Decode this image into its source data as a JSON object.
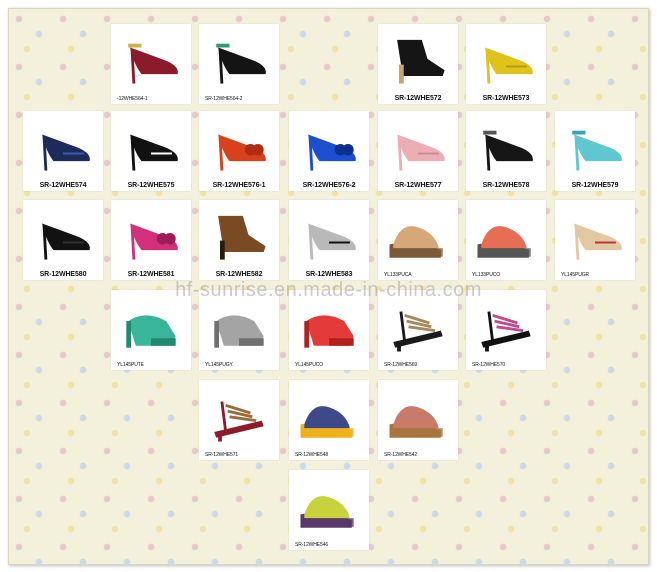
{
  "watermark": "hf-sunrise.en.made-in-china.com",
  "products": [
    {
      "label": "-12WHE564-1",
      "small": true,
      "color": "#8b1a2a",
      "accent": "#c9b24a",
      "style": "strap"
    },
    {
      "label": "SR-12WHE564-2",
      "small": true,
      "color": "#141414",
      "accent": "#2f9e6e",
      "style": "strap"
    },
    {
      "label": "SR-12WHE572",
      "small": false,
      "color": "#151515",
      "accent": "#c9a36a",
      "style": "bootie"
    },
    {
      "label": "SR-12WHE573",
      "small": false,
      "color": "#e0c21c",
      "accent": "#b99a10",
      "style": "pump"
    },
    {
      "label": "SR-12WHE574",
      "small": false,
      "color": "#1d2b5a",
      "accent": "#3c5bb0",
      "style": "pump"
    },
    {
      "label": "SR-12WHE575",
      "small": false,
      "color": "#111111",
      "accent": "#ffffff",
      "style": "pump"
    },
    {
      "label": "SR-12WHE576-1",
      "small": false,
      "color": "#d9401c",
      "accent": "#b02c10",
      "style": "bow"
    },
    {
      "label": "SR-12WHE576-2",
      "small": false,
      "color": "#1b4fcf",
      "accent": "#0d2f8f",
      "style": "bow"
    },
    {
      "label": "SR-12WHE577",
      "small": false,
      "color": "#ecaeb5",
      "accent": "#d18a92",
      "style": "pump"
    },
    {
      "label": "SR-12WHE578",
      "small": false,
      "color": "#161616",
      "accent": "#555555",
      "style": "strap"
    },
    {
      "label": "SR-12WHE579",
      "small": false,
      "color": "#5fc7cf",
      "accent": "#3aa3ad",
      "style": "strap"
    },
    {
      "label": "SR-12WHE580",
      "small": false,
      "color": "#121212",
      "accent": "#333333",
      "style": "pump"
    },
    {
      "label": "SR-12WHE581",
      "small": false,
      "color": "#d2307a",
      "accent": "#a01b59",
      "style": "bow"
    },
    {
      "label": "SR-12WHE582",
      "small": false,
      "color": "#7a4a22",
      "accent": "#2a1a0c",
      "style": "bootie"
    },
    {
      "label": "SR-12WHE583",
      "small": false,
      "color": "#b9b9b9",
      "accent": "#111111",
      "style": "pump"
    },
    {
      "label": "YL133PUCA",
      "small": true,
      "color": "#d6a878",
      "accent": "#7a5a3a",
      "style": "wedge"
    },
    {
      "label": "YL133PUCO",
      "small": true,
      "color": "#e76d55",
      "accent": "#555555",
      "style": "wedge"
    },
    {
      "label": "YL145PUGR",
      "small": true,
      "color": "#e2c8a3",
      "accent": "#b8373a",
      "style": "pump"
    },
    {
      "label": "YL145PUTE",
      "small": true,
      "color": "#39b59a",
      "accent": "#1f8a70",
      "style": "platform"
    },
    {
      "label": "YL145PUGY",
      "small": true,
      "color": "#a4a4a4",
      "accent": "#6f6f6f",
      "style": "platform"
    },
    {
      "label": "YL145PUCO",
      "small": true,
      "color": "#e53a3a",
      "accent": "#b31e1e",
      "style": "platform"
    },
    {
      "label": "SR-12WHE569",
      "small": true,
      "color": "#1a1a1a",
      "accent": "#a48a5a",
      "style": "sandal"
    },
    {
      "label": "SR-12WHE570",
      "small": true,
      "color": "#101010",
      "accent": "#c04a8a",
      "style": "sandal"
    },
    {
      "label": "SR-12WHE571",
      "small": true,
      "color": "#8c1b2c",
      "accent": "#9a6b3a",
      "style": "sandal"
    },
    {
      "label": "SR-12WHE548",
      "small": true,
      "color": "#3d4a8a",
      "accent": "#f0b11c",
      "style": "wedge"
    },
    {
      "label": "SR-12WHE542",
      "small": true,
      "color": "#c97b6a",
      "accent": "#a8753e",
      "style": "wedge"
    },
    {
      "label": "SR-12WHE546",
      "small": true,
      "color": "#c8d23a",
      "accent": "#5a3a6a",
      "style": "wedge"
    }
  ]
}
